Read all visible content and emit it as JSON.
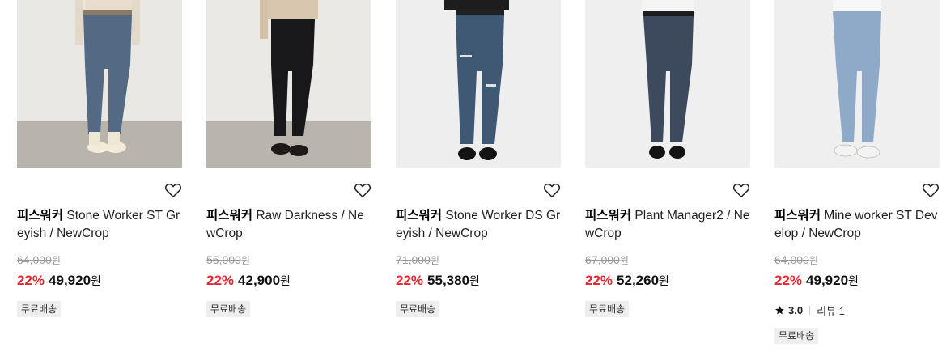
{
  "colors": {
    "discount": "#e8252f",
    "badge_bg": "#eeeeee",
    "strike": "#9a9a9a"
  },
  "products": [
    {
      "brand": "피스워커",
      "name": "Stone Worker ST Greyish / NewCrop",
      "original_price": "64,000",
      "original_unit": "원",
      "discount": "22%",
      "price": "49,920",
      "price_unit": "원",
      "badge": "무료배송",
      "wishlist_icon": "heart-outline-icon"
    },
    {
      "brand": "피스워커",
      "name": "Raw Darkness / NewCrop",
      "original_price": "55,000",
      "original_unit": "원",
      "discount": "22%",
      "price": "42,900",
      "price_unit": "원",
      "badge": "무료배송",
      "wishlist_icon": "heart-outline-icon"
    },
    {
      "brand": "피스워커",
      "name": "Stone Worker DS Greyish / NewCrop",
      "original_price": "71,000",
      "original_unit": "원",
      "discount": "22%",
      "price": "55,380",
      "price_unit": "원",
      "badge": "무료배송",
      "wishlist_icon": "heart-outline-icon"
    },
    {
      "brand": "피스워커",
      "name": "Plant Manager2 / NewCrop",
      "original_price": "67,000",
      "original_unit": "원",
      "discount": "22%",
      "price": "52,260",
      "price_unit": "원",
      "badge": "무료배송",
      "wishlist_icon": "heart-outline-icon"
    },
    {
      "brand": "피스워커",
      "name": "Mine worker ST Develop / NewCrop",
      "original_price": "64,000",
      "original_unit": "원",
      "discount": "22%",
      "price": "49,920",
      "price_unit": "원",
      "rating": "3.0",
      "review": "리뷰 1",
      "badge": "무료배송",
      "wishlist_icon": "heart-outline-icon"
    }
  ]
}
